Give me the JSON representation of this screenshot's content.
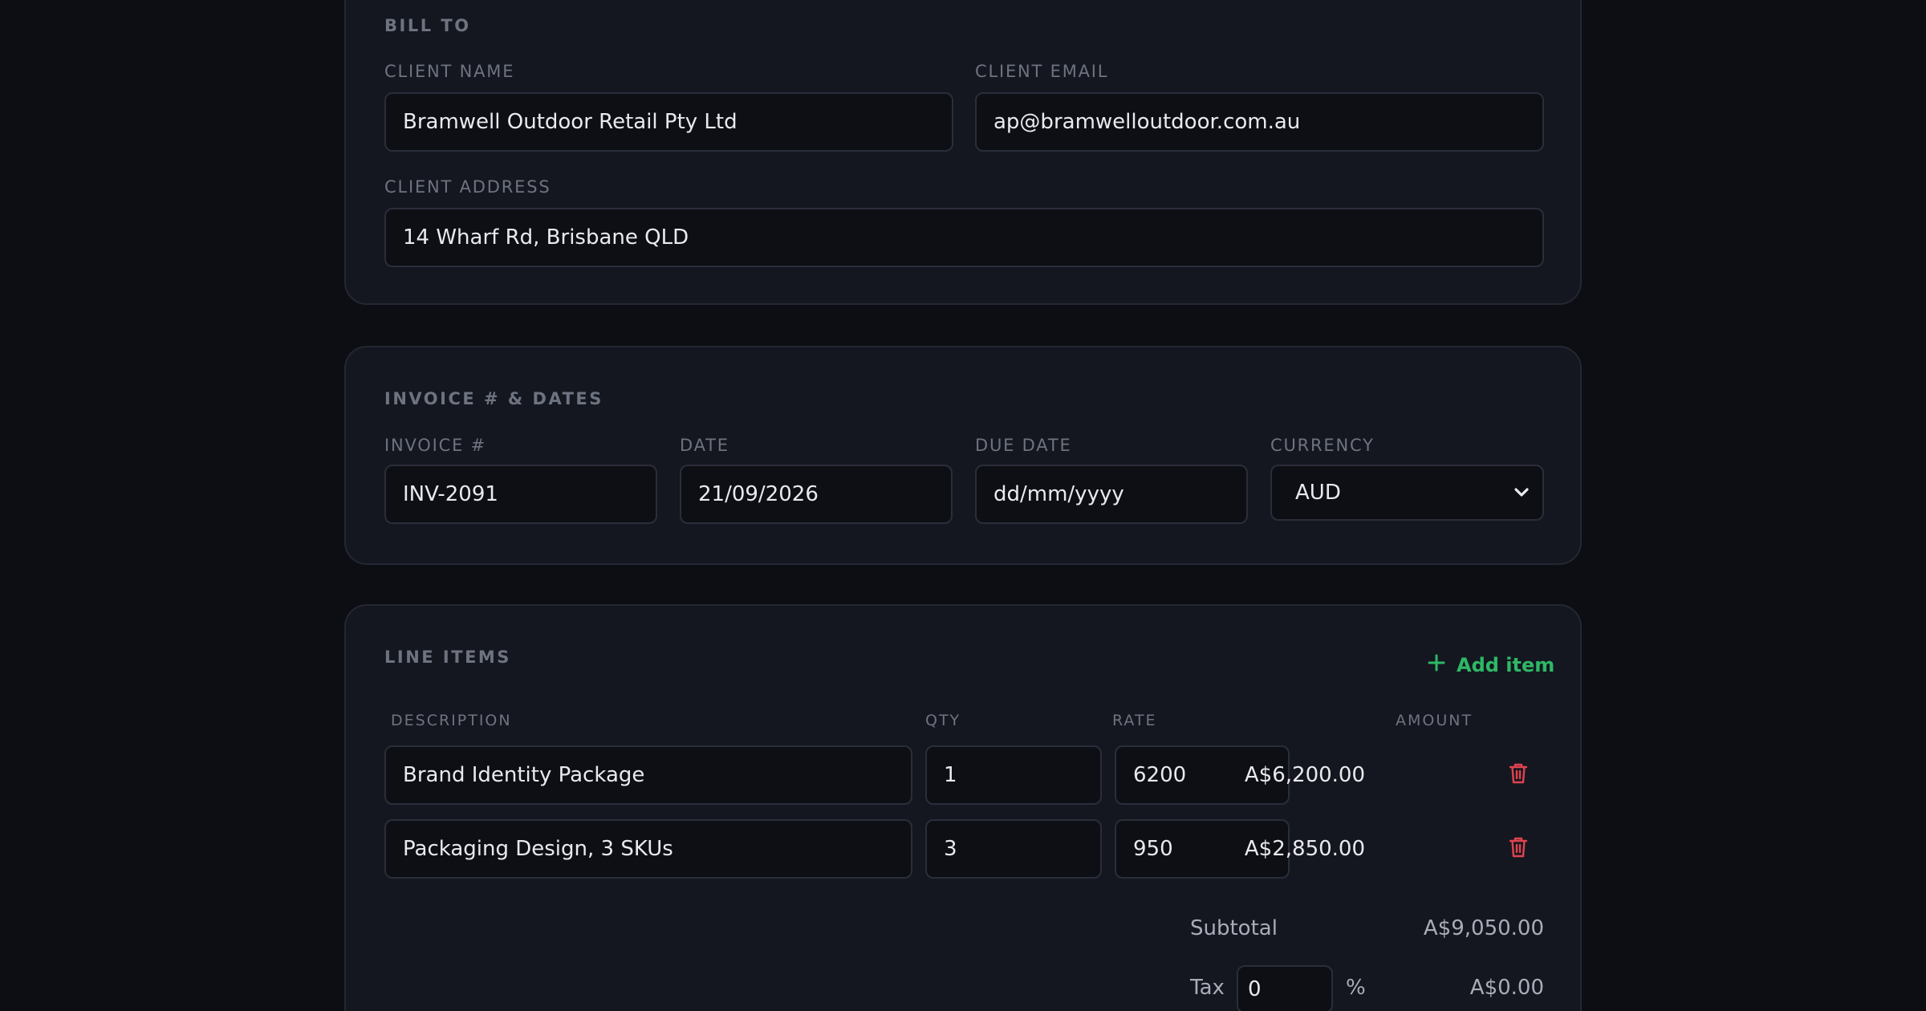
{
  "bill_to": {
    "title": "BILL TO",
    "client_name_label": "CLIENT NAME",
    "client_name_value": "Bramwell Outdoor Retail Pty Ltd",
    "client_email_label": "CLIENT EMAIL",
    "client_email_value": "ap@bramwelloutdoor.com.au",
    "client_address_label": "CLIENT ADDRESS",
    "client_address_value": "14 Wharf Rd, Brisbane QLD"
  },
  "invoice": {
    "title": "INVOICE # & DATES",
    "number_label": "INVOICE #",
    "number_value": "INV-2091",
    "date_label": "DATE",
    "date_value": "21/09/2026",
    "due_date_label": "DUE DATE",
    "due_date_placeholder": "dd/mm/yyyy",
    "currency_label": "CURRENCY",
    "currency_value": "AUD"
  },
  "line_items": {
    "title": "LINE ITEMS",
    "add_label": "Add item",
    "columns": {
      "description": "DESCRIPTION",
      "qty": "QTY",
      "rate": "RATE",
      "amount": "AMOUNT"
    },
    "rows": [
      {
        "description": "Brand Identity Package",
        "qty": "1",
        "rate": "6200",
        "amount": "A$6,200.00"
      },
      {
        "description": "Packaging Design, 3 SKUs",
        "qty": "3",
        "rate": "950",
        "amount": "A$2,850.00"
      }
    ]
  },
  "totals": {
    "subtotal_label": "Subtotal",
    "subtotal_value": "A$9,050.00",
    "tax_label": "Tax",
    "tax_percent": "0",
    "tax_unit": "%",
    "tax_value": "A$0.00"
  },
  "colors": {
    "accent_green": "#2fb866",
    "danger_red": "#e0434f",
    "background": "#0d0e13",
    "card": "#141720"
  },
  "icons": {
    "add": "plus-icon",
    "delete": "trash-icon",
    "select": "chevron-down-icon"
  }
}
